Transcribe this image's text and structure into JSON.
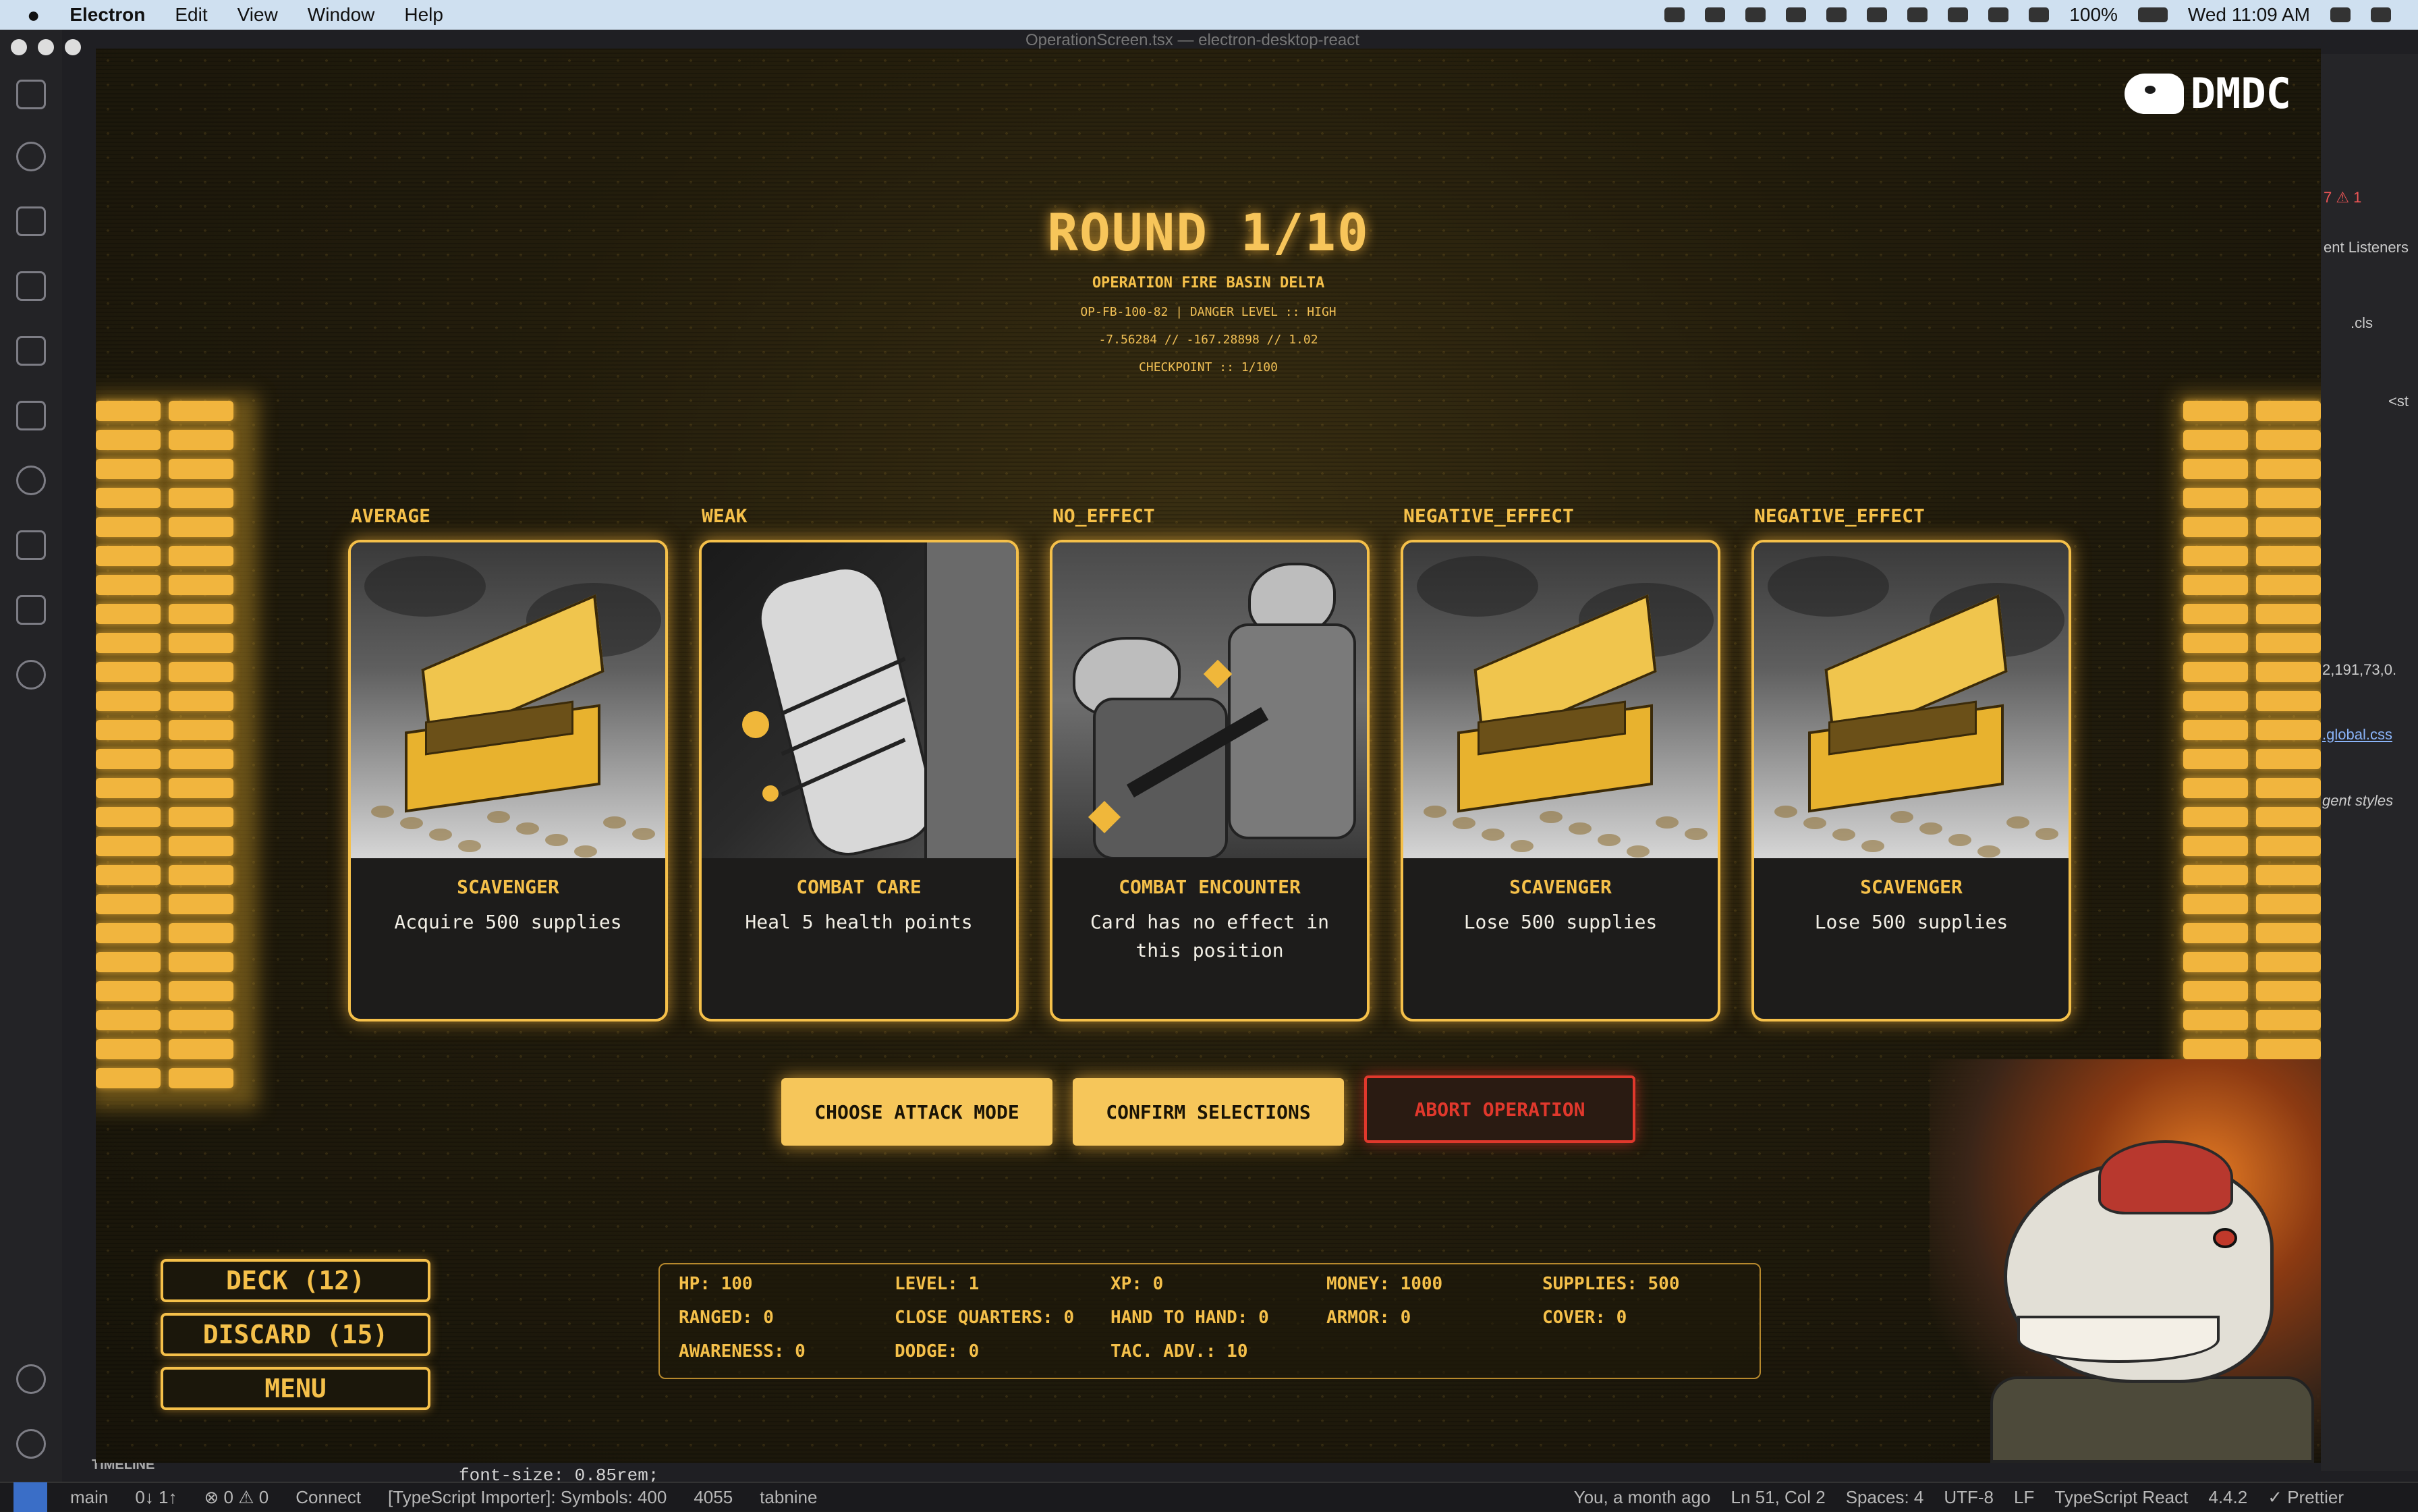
{
  "menubar": {
    "app": "Electron",
    "items": [
      "Edit",
      "View",
      "Window",
      "Help"
    ],
    "battery": "100%",
    "clock": "Wed 11:09 AM"
  },
  "vscode": {
    "window_title": "OperationScreen.tsx — electron-desktop-react",
    "timeline": "TIMELINE",
    "code_line": "font-size: 0.85rem;",
    "right_panel": {
      "listeners": "ent Listeners",
      "cls": ".cls",
      "st": "<st",
      "color": "2,191,73,0.",
      "global": ".global.css",
      "agent": "gent styles",
      "counts": "7 ⚠ 1"
    },
    "statusbar": {
      "branch": "main",
      "sync": "0↓ 1↑",
      "problems": "⊗ 0 ⚠ 0",
      "connect": "Connect",
      "importer": "[TypeScript Importer]: Symbols: 400",
      "port": "4055",
      "tabnine": "tabnine",
      "blame": "You, a month ago",
      "position": "Ln 51, Col 2",
      "spaces": "Spaces: 4",
      "encoding": "UTF-8",
      "eol": "LF",
      "language": "TypeScript React",
      "version": "4.4.2",
      "prettier": "✓ Prettier"
    }
  },
  "game": {
    "logo": "DMDC",
    "round": "ROUND 1/10",
    "operation": "OPERATION FIRE BASIN DELTA",
    "meta1": "OP-FB-100-82 | DANGER LEVEL :: HIGH",
    "meta2": "-7.56284 // -167.28898 // 1.02",
    "meta3": "CHECKPOINT :: 1/100",
    "cards": [
      {
        "position_label": "AVERAGE",
        "title": "SCAVENGER",
        "desc": "Acquire 500 supplies",
        "art": "supply-chest"
      },
      {
        "position_label": "WEAK",
        "title": "COMBAT CARE",
        "desc": "Heal 5 health points",
        "art": "bandaged-arm"
      },
      {
        "position_label": "NO_EFFECT",
        "title": "COMBAT ENCOUNTER",
        "desc": "Card has no effect in this position",
        "art": "dino-soldiers"
      },
      {
        "position_label": "NEGATIVE_EFFECT",
        "title": "SCAVENGER",
        "desc": "Lose 500 supplies",
        "art": "supply-chest"
      },
      {
        "position_label": "NEGATIVE_EFFECT",
        "title": "SCAVENGER",
        "desc": "Lose 500 supplies",
        "art": "supply-chest"
      }
    ],
    "buttons": {
      "attack": "CHOOSE ATTACK MODE",
      "confirm": "CONFIRM SELECTIONS",
      "abort": "ABORT OPERATION"
    },
    "side_menu": {
      "deck": "DECK (12)",
      "discard": "DISCARD (15)",
      "menu": "MENU"
    },
    "stats": {
      "hp": "HP: 100",
      "level": "LEVEL: 1",
      "xp": "XP: 0",
      "money": "MONEY: 1000",
      "supplies": "SUPPLIES: 500",
      "ranged": "RANGED: 0",
      "close_quarters": "CLOSE QUARTERS: 0",
      "hand_to_hand": "HAND TO HAND: 0",
      "armor": "ARMOR: 0",
      "cover": "COVER: 0",
      "awareness": "AWARENESS: 0",
      "dodge": "DODGE: 0",
      "tac_adv": "TAC. ADV.: 10"
    },
    "colors": {
      "accent": "#f5c04a",
      "danger": "#e0382c",
      "background": "#1f1a0c"
    }
  }
}
